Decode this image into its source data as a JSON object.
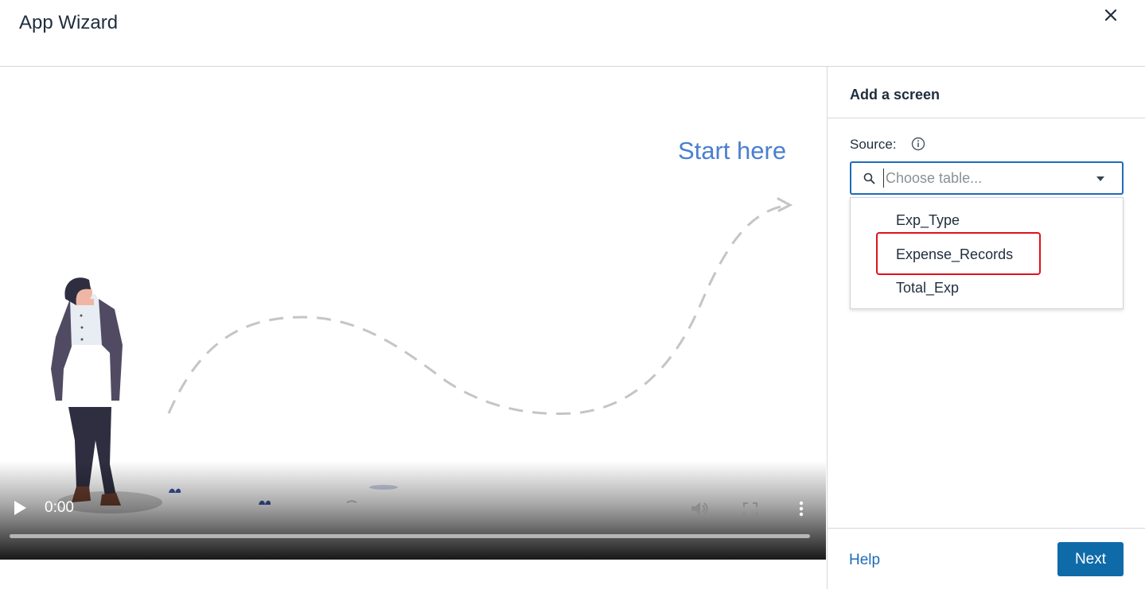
{
  "window": {
    "title": "App Wizard",
    "close_icon": "close-icon"
  },
  "video": {
    "start_label": "Start here",
    "time": "0:00",
    "progress": 0,
    "controls": [
      "play-icon",
      "volume-icon",
      "fullscreen-icon",
      "more-vertical-icon"
    ]
  },
  "panel": {
    "title": "Add a screen",
    "source_label": "Source:",
    "info_icon": "info-icon",
    "select": {
      "placeholder": "Choose table...",
      "value": "",
      "search_icon": "search-icon",
      "caret_icon": "caret-down-icon"
    },
    "options": [
      "Exp_Type",
      "Expense_Records",
      "Total_Exp"
    ],
    "highlighted_option": "Expense_Records",
    "highlight_color": "#e0121b"
  },
  "footer": {
    "help_label": "Help",
    "next_label": "Next"
  },
  "colors": {
    "accent": "#1e6bb8",
    "primary_button": "#0f6aa8",
    "start_text": "#4a7fcf"
  }
}
